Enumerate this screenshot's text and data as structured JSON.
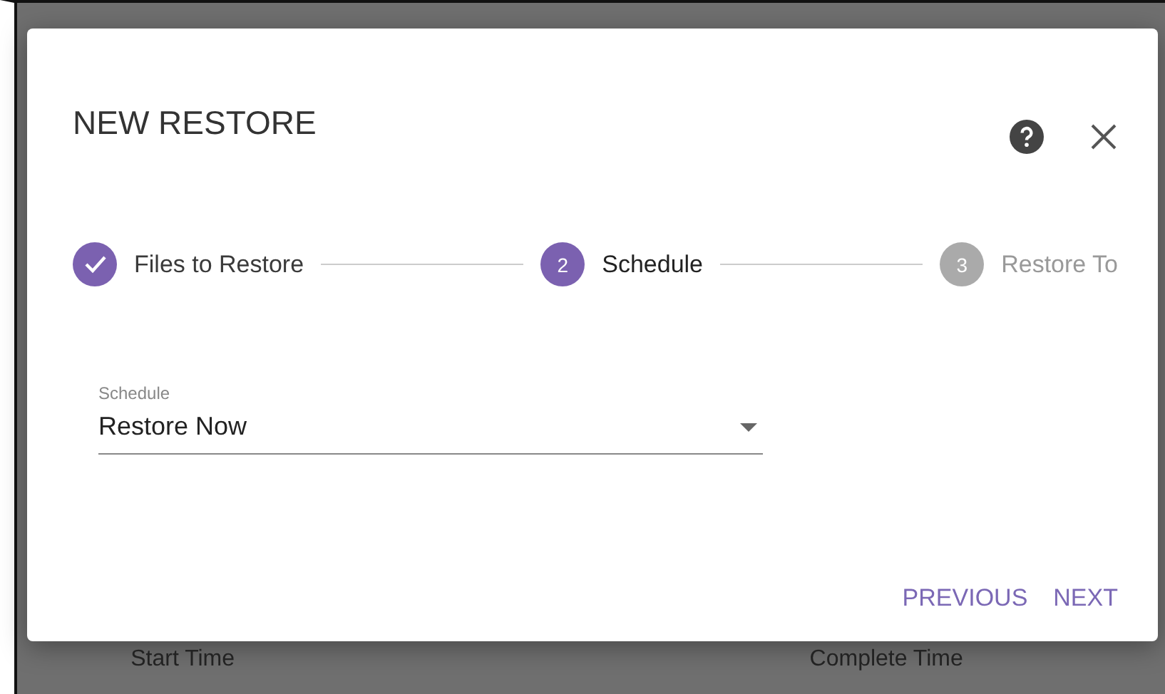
{
  "dialog": {
    "title": "NEW RESTORE",
    "steps": [
      {
        "label": "Files to Restore",
        "completed": true,
        "selected": false
      },
      {
        "label": "Schedule",
        "number": "2",
        "completed": false,
        "selected": true
      },
      {
        "label": "Restore To",
        "number": "3",
        "completed": false,
        "selected": false
      }
    ],
    "schedule_field": {
      "label": "Schedule",
      "value": "Restore Now"
    },
    "buttons": [
      "PREVIOUS",
      "NEXT"
    ]
  },
  "background_columns": [
    "Start Time",
    "Complete Time"
  ]
}
